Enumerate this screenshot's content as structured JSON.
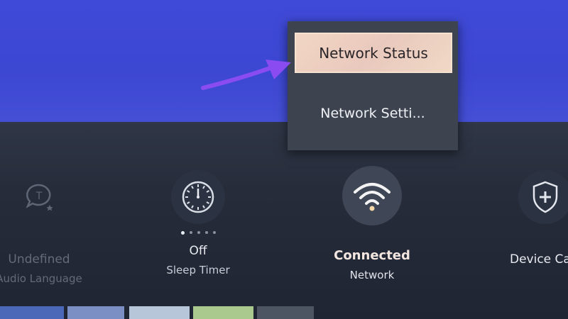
{
  "menu": {
    "selected_label": "Network Status",
    "second_label": "Network Setti..."
  },
  "tiles": [
    {
      "value": "Undefined",
      "caption": "Audio Language",
      "icon": "chat-t-icon"
    },
    {
      "value": "Off",
      "caption": "Sleep Timer",
      "icon": "clock-icon"
    },
    {
      "value": "Connected",
      "caption": "Network",
      "icon": "wifi-icon"
    },
    {
      "value": "Device Car",
      "caption": "",
      "icon": "shield-plus-icon"
    }
  ],
  "colors": {
    "background_top": "#3f4ad8",
    "panel": "#262c3a",
    "menu": "#3e4350",
    "selected": "#f2d6c4",
    "arrow": "#8a4cf0",
    "wifi_active": "#f5d7a8"
  }
}
